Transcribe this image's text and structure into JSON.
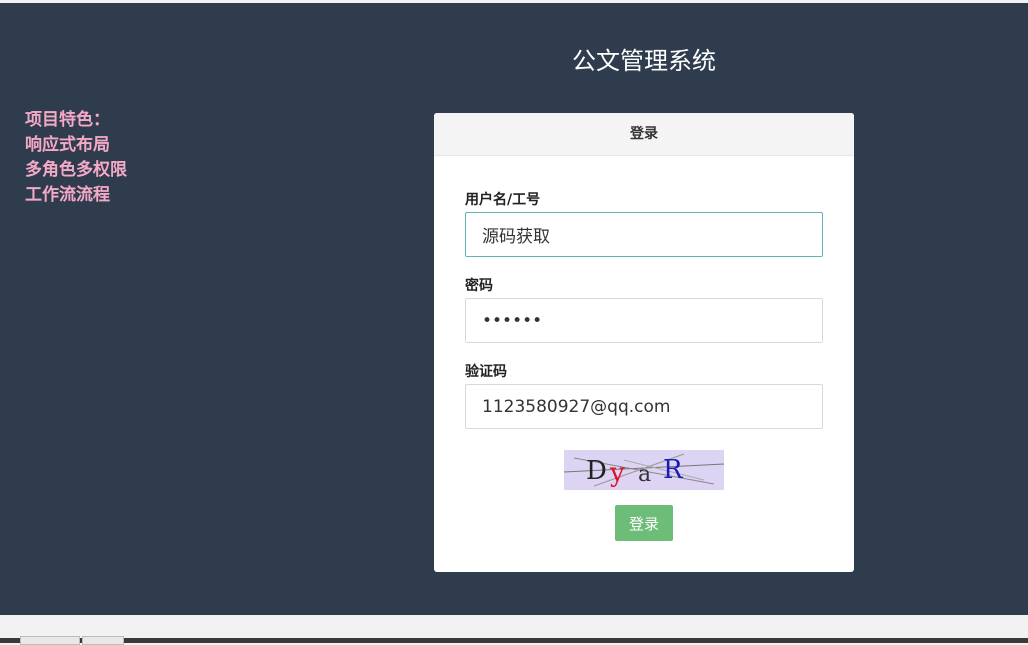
{
  "page": {
    "system_title": "公文管理系统"
  },
  "features": {
    "heading": "项目特色：",
    "items": [
      "响应式布局",
      "多角色多权限",
      "工作流流程"
    ]
  },
  "login_form": {
    "header": "登录",
    "username": {
      "label": "用户名/工号",
      "value": "源码获取"
    },
    "password": {
      "label": "密码",
      "value": "••••••"
    },
    "captcha": {
      "label": "验证码",
      "value": "1123580927@qq.com",
      "image_text": [
        "D",
        "y",
        "a",
        "R"
      ]
    },
    "submit_label": "登录"
  },
  "colors": {
    "background": "#2e3c4e",
    "feature_text": "#f4a9c6",
    "button": "#6dbd78",
    "focus_border": "#5fb2bb",
    "captcha_bg": "#dcd4f2"
  }
}
